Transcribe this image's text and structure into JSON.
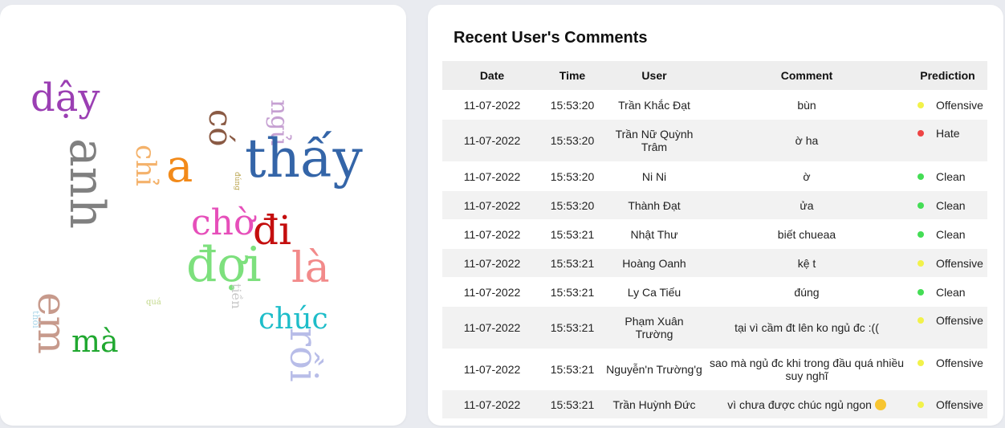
{
  "wordcloud": {
    "words": [
      {
        "text": "dậy",
        "color": "#9b3fb3"
      },
      {
        "text": "anh",
        "color": "#808080"
      },
      {
        "text": "chỉ",
        "color": "#f4b26b"
      },
      {
        "text": "a",
        "color": "#f28a1a"
      },
      {
        "text": "có",
        "color": "#8a5a44"
      },
      {
        "text": "ngủ",
        "color": "#c6a0d2"
      },
      {
        "text": "thấy",
        "color": "#3465a8"
      },
      {
        "text": "đúng",
        "color": "#b8a24a"
      },
      {
        "text": "chờ",
        "color": "#e64fba"
      },
      {
        "text": "đi",
        "color": "#c40e0e"
      },
      {
        "text": "đợi",
        "color": "#7de07d"
      },
      {
        "text": "là",
        "color": "#f28a8a"
      },
      {
        "text": "tiền",
        "color": "#c8c8c8"
      },
      {
        "text": "quá",
        "color": "#c2d88a"
      },
      {
        "text": "em",
        "color": "#c79a8c"
      },
      {
        "text": "thôi",
        "color": "#a8d4e8"
      },
      {
        "text": "mà",
        "color": "#20a830"
      },
      {
        "text": "chúc",
        "color": "#1ebdc9"
      },
      {
        "text": "rồi",
        "color": "#b8bde8"
      }
    ]
  },
  "table": {
    "title": "Recent User's Comments",
    "headers": {
      "date": "Date",
      "time": "Time",
      "user": "User",
      "comment": "Comment",
      "prediction": "Prediction"
    },
    "rows": [
      {
        "date": "11-07-2022",
        "time": "15:53:20",
        "user": "Trần Khắc Đạt",
        "comment": "bùn",
        "prediction": "Offensive"
      },
      {
        "date": "11-07-2022",
        "time": "15:53:20",
        "user": "Trần Nữ Quỳnh Trâm",
        "comment": "ờ ha",
        "prediction": "Hate"
      },
      {
        "date": "11-07-2022",
        "time": "15:53:20",
        "user": "Ni Ni",
        "comment": "ờ",
        "prediction": "Clean"
      },
      {
        "date": "11-07-2022",
        "time": "15:53:20",
        "user": "Thành Đạt",
        "comment": "ửa",
        "prediction": "Clean"
      },
      {
        "date": "11-07-2022",
        "time": "15:53:21",
        "user": "Nhật Thư",
        "comment": "biết chueaa",
        "prediction": "Clean"
      },
      {
        "date": "11-07-2022",
        "time": "15:53:21",
        "user": "Hoàng Oanh",
        "comment": "kệ t",
        "prediction": "Offensive"
      },
      {
        "date": "11-07-2022",
        "time": "15:53:21",
        "user": "Ly Ca Tiếu",
        "comment": "đúng",
        "prediction": "Clean"
      },
      {
        "date": "11-07-2022",
        "time": "15:53:21",
        "user": "Phạm Xuân Trường",
        "comment": "tại vì cầm đt lên ko ngủ đc :((",
        "prediction": "Offensive"
      },
      {
        "date": "11-07-2022",
        "time": "15:53:21",
        "user": "Nguyễn'n Trường'g",
        "comment": "sao mà ngủ đc khi trong đầu quá nhiều suy nghĩ",
        "prediction": "Offensive"
      },
      {
        "date": "11-07-2022",
        "time": "15:53:21",
        "user": "Trần Huỳnh Đức",
        "comment": "vì chưa được chúc ngủ ngon",
        "prediction": "Offensive",
        "emoji": "disappointed-face-emoji"
      }
    ]
  },
  "colors": {
    "Offensive": "#f2f24a",
    "Hate": "#ee4444",
    "Clean": "#44dd55"
  }
}
